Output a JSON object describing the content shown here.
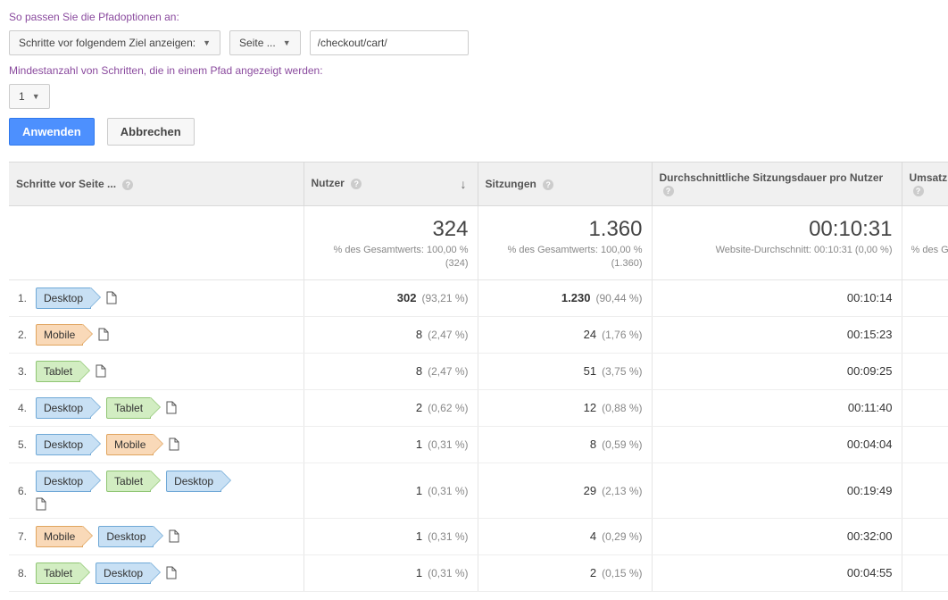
{
  "labels": {
    "pathOptions": "So passen Sie die Pfadoptionen an:",
    "minSteps": "Mindestanzahl von Schritten, die in einem Pfad angezeigt werden:"
  },
  "controls": {
    "stepsDropdown": "Schritte vor folgendem Ziel anzeigen:",
    "pageDropdown": "Seite ...",
    "pathInput": "/checkout/cart/",
    "minStepsValue": "1",
    "apply": "Anwenden",
    "cancel": "Abbrechen"
  },
  "table": {
    "headers": {
      "steps": "Schritte vor Seite ...",
      "users": "Nutzer",
      "sessions": "Sitzungen",
      "avgDuration": "Durchschnittliche Sitzungsdauer pro Nutzer",
      "revenue": "Umsatz"
    },
    "summary": {
      "users": {
        "big": "324",
        "sub1": "% des Gesamtwerts: 100,00 %",
        "sub2": "(324)"
      },
      "sessions": {
        "big": "1.360",
        "sub1": "% des Gesamtwerts: 100,00 %",
        "sub2": "(1.360)"
      },
      "avg": {
        "big": "00:10:31",
        "sub1": "Website-Durchschnitt: 00:10:31 (0,00 %)"
      },
      "revenue": {
        "sub1": "% des Gesar"
      }
    },
    "rows": [
      {
        "idx": "1.",
        "steps": [
          [
            "Desktop",
            "desktop"
          ]
        ],
        "users": "302",
        "usersPct": "(93,21 %)",
        "sessions": "1.230",
        "sessionsPct": "(90,44 %)",
        "avg": "00:10:14",
        "bold": true
      },
      {
        "idx": "2.",
        "steps": [
          [
            "Mobile",
            "mobile"
          ]
        ],
        "users": "8",
        "usersPct": "(2,47 %)",
        "sessions": "24",
        "sessionsPct": "(1,76 %)",
        "avg": "00:15:23"
      },
      {
        "idx": "3.",
        "steps": [
          [
            "Tablet",
            "tablet"
          ]
        ],
        "users": "8",
        "usersPct": "(2,47 %)",
        "sessions": "51",
        "sessionsPct": "(3,75 %)",
        "avg": "00:09:25"
      },
      {
        "idx": "4.",
        "steps": [
          [
            "Desktop",
            "desktop"
          ],
          [
            "Tablet",
            "tablet"
          ]
        ],
        "users": "2",
        "usersPct": "(0,62 %)",
        "sessions": "12",
        "sessionsPct": "(0,88 %)",
        "avg": "00:11:40"
      },
      {
        "idx": "5.",
        "steps": [
          [
            "Desktop",
            "desktop"
          ],
          [
            "Mobile",
            "mobile"
          ]
        ],
        "users": "1",
        "usersPct": "(0,31 %)",
        "sessions": "8",
        "sessionsPct": "(0,59 %)",
        "avg": "00:04:04"
      },
      {
        "idx": "6.",
        "steps": [
          [
            "Desktop",
            "desktop"
          ],
          [
            "Tablet",
            "tablet"
          ],
          [
            "Desktop",
            "desktop"
          ]
        ],
        "users": "1",
        "usersPct": "(0,31 %)",
        "sessions": "29",
        "sessionsPct": "(2,13 %)",
        "avg": "00:19:49",
        "wrap": true
      },
      {
        "idx": "7.",
        "steps": [
          [
            "Mobile",
            "mobile"
          ],
          [
            "Desktop",
            "desktop"
          ]
        ],
        "users": "1",
        "usersPct": "(0,31 %)",
        "sessions": "4",
        "sessionsPct": "(0,29 %)",
        "avg": "00:32:00"
      },
      {
        "idx": "8.",
        "steps": [
          [
            "Tablet",
            "tablet"
          ],
          [
            "Desktop",
            "desktop"
          ]
        ],
        "users": "1",
        "usersPct": "(0,31 %)",
        "sessions": "2",
        "sessionsPct": "(0,15 %)",
        "avg": "00:04:55"
      }
    ]
  }
}
